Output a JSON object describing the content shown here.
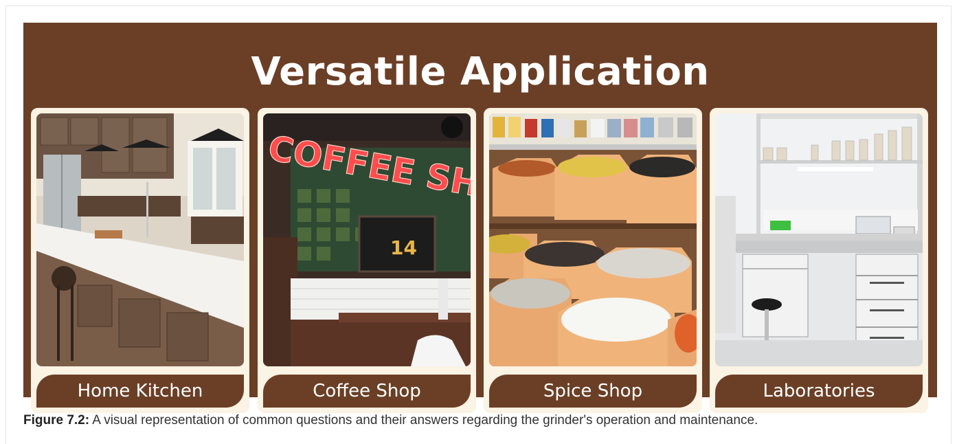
{
  "banner": {
    "title": "Versatile Application",
    "background_color": "#6b3f26",
    "card_color": "#fbf3e3"
  },
  "cards": [
    {
      "label": "Home Kitchen",
      "photo": "kitchen-photo"
    },
    {
      "label": "Coffee Shop",
      "photo": "coffee-shop-photo"
    },
    {
      "label": "Spice Shop",
      "photo": "spice-shop-photo"
    },
    {
      "label": "Laboratories",
      "photo": "laboratory-photo"
    }
  ],
  "caption": {
    "prefix": "Figure 7.2:",
    "text": " A visual representation of common questions and their answers regarding the grinder's operation and maintenance."
  },
  "photo_text": {
    "coffee_sign": "COFFEE SHO",
    "menu_number": "14"
  }
}
